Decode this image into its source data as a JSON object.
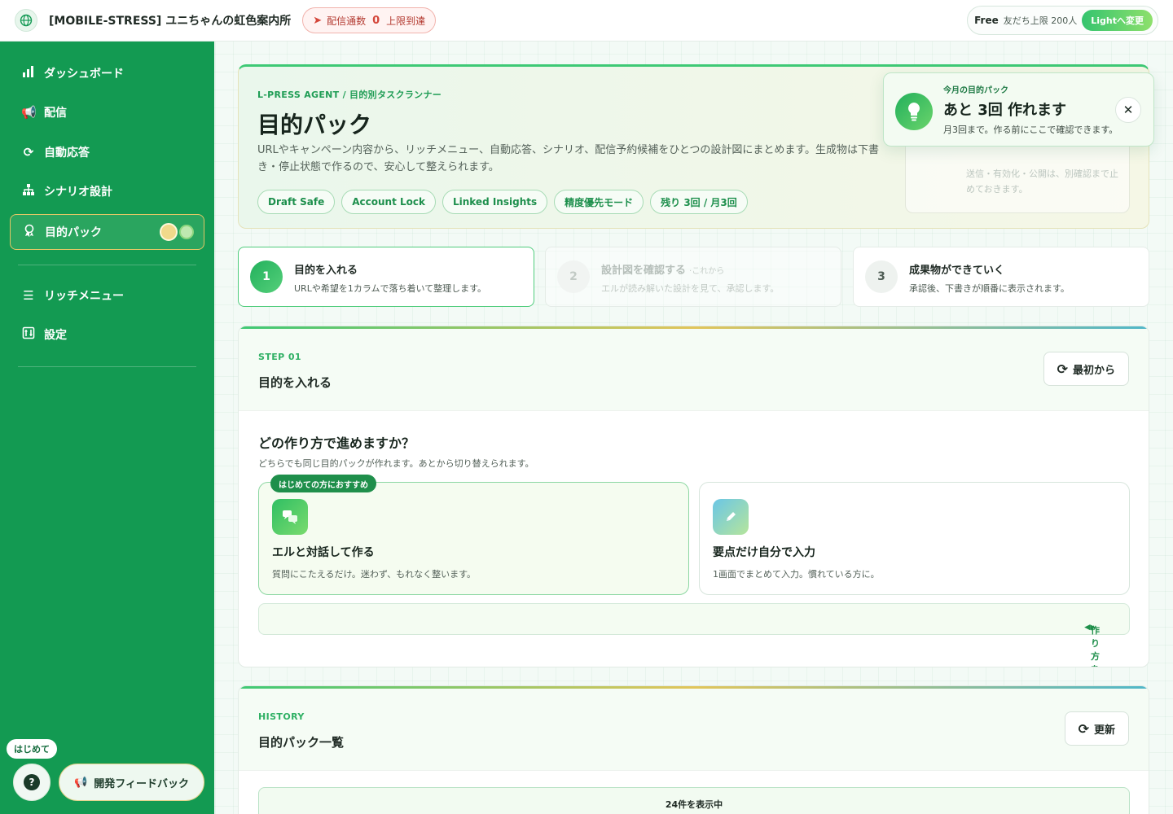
{
  "header": {
    "title": "[MOBILE-STRESS] ユニちゃんの虹色案内所",
    "limit_label": "配信通数",
    "limit_count": "0",
    "limit_status": "上限到達",
    "plan": "Free",
    "friends_limit": "友だち上限 200人",
    "change_plan": "Lightへ変更"
  },
  "sidebar": {
    "items": [
      {
        "label": "ダッシュボード",
        "icon": "bar-chart-icon"
      },
      {
        "label": "配信",
        "icon": "megaphone-icon"
      },
      {
        "label": "自動応答",
        "icon": "refresh-icon"
      },
      {
        "label": "シナリオ設計",
        "icon": "sitemap-icon"
      },
      {
        "label": "目的パック",
        "icon": "award-icon"
      },
      {
        "label": "リッチメニュー",
        "icon": "menu-icon"
      },
      {
        "label": "設定",
        "icon": "settings-icon"
      }
    ],
    "hajime": "はじめて",
    "help": "?",
    "feedback": "開発フィードバック"
  },
  "hero": {
    "kicker": "L-PRESS AGENT / 目的別タスクランナー",
    "title": "目的パック",
    "description": "URLやキャンペーン内容から、リッチメニュー、自動応答、シナリオ、配信予約候補をひとつの設計図にまとめます。生成物は下書き・停止状態で作るので、安心して整えられます。",
    "chips": [
      "Draft Safe",
      "Account Lock",
      "Linked Insights",
      "精度優先モード",
      "残り 3回 / 月3回"
    ],
    "side_note": "送信・有効化・公開は、別確認まで止めておきます。"
  },
  "popup": {
    "small": "今月の目的パック",
    "big": "あと 3回 作れます",
    "sub": "月3回まで。作る前にここで確認できます。",
    "close": "✕"
  },
  "steps": [
    {
      "num": "1",
      "title": "目的を入れる",
      "note": "",
      "sub": "URLや希望を1カラムで落ち着いて整理します。"
    },
    {
      "num": "2",
      "title": "設計図を確認する",
      "note": "·これから",
      "sub": "エルが読み解いた設計を見て、承認します。"
    },
    {
      "num": "3",
      "title": "成果物ができていく",
      "note": "",
      "sub": "承認後、下書きが順番に表示されます。"
    }
  ],
  "step_panel": {
    "kicker": "STEP 01",
    "title": "目的を入れる",
    "reset": "最初から",
    "question": "どの作り方で進めますか？",
    "question_sub": "どちらでも同じ目的パックが作れます。あとから切り替えられます。",
    "choices": [
      {
        "badge": "はじめての方におすすめ",
        "title": "エルと対話して作る",
        "sub": "質問にこたえるだけ。迷わず、もれなく整います。",
        "icon": "chat-icon"
      },
      {
        "badge": "",
        "title": "要点だけ自分で入力",
        "sub": "1画面でまとめて入力。慣れている方に。",
        "icon": "pencil-icon"
      }
    ],
    "reselect": "作り方を選び直す"
  },
  "history": {
    "kicker": "HISTORY",
    "title": "目的パック一覧",
    "refresh": "更新",
    "count": "24件を表示中"
  }
}
